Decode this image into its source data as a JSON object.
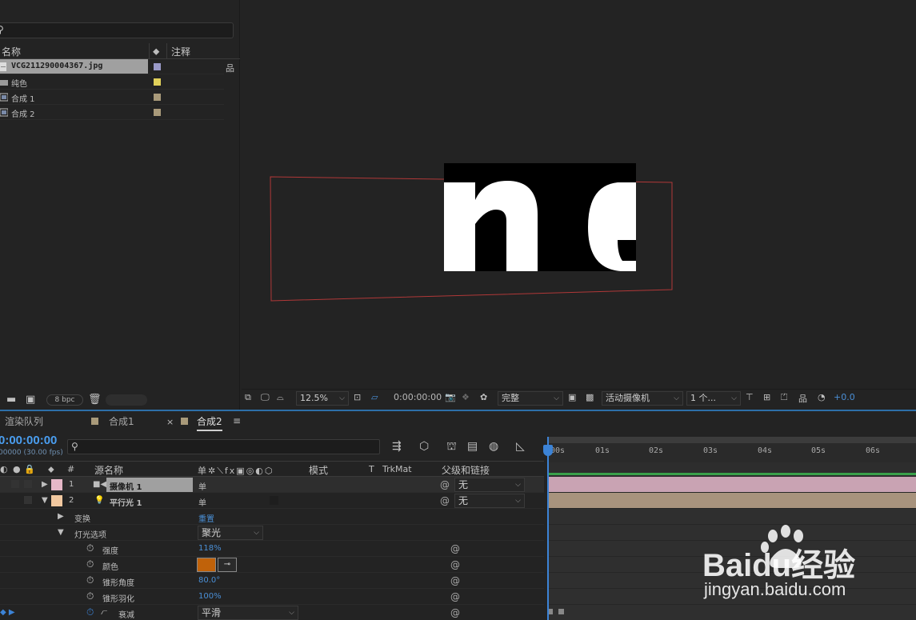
{
  "project": {
    "column_name": "名称",
    "column_comment": "注释",
    "items": [
      {
        "name": "VCG211290004367.jpg",
        "icon": "file-icon",
        "color": "#9a9ac8"
      },
      {
        "name": "纯色",
        "icon": "folder-icon",
        "color": "#e0d05a"
      },
      {
        "name": "合成 1",
        "icon": "composition-icon",
        "color": "#a99a7a"
      },
      {
        "name": "合成 2",
        "icon": "composition-icon",
        "color": "#a99a7a"
      }
    ],
    "bpc_label": "8 bpc"
  },
  "viewer": {
    "zoom": "12.5%",
    "timecode": "0:00:00:00",
    "resolution": "完整",
    "camera": "活动摄像机",
    "views": "1 个...",
    "exposure": "+0.0",
    "artwork_text": "ne"
  },
  "timeline": {
    "tabs": [
      {
        "label": "渲染队列"
      },
      {
        "label": "合成1"
      },
      {
        "label": "合成2"
      }
    ],
    "current_time": "0:00:00:00",
    "fps_text": "00000 (30.00 fps)",
    "columns": {
      "number": "#",
      "source_name": "源名称",
      "mode": "模式",
      "t": "T",
      "trkmat": "TrkMat",
      "parent": "父级和链接"
    },
    "layers": [
      {
        "index": "1",
        "name": "摄像机 1",
        "color": "#e6b8c8",
        "parent": "无",
        "switch": "单"
      },
      {
        "index": "2",
        "name": "平行光 1",
        "color": "#f2c8a0",
        "parent": "无",
        "switch": "单"
      }
    ],
    "properties": {
      "transform_label": "变换",
      "transform_value": "重置",
      "light_options_label": "灯光选项",
      "light_type": "聚光",
      "intensity_label": "强度",
      "intensity_value": "118%",
      "color_label": "颜色",
      "color_value": "#c0620a",
      "cone_angle_label": "锥形角度",
      "cone_angle_value": "80.0°",
      "cone_feather_label": "锥形羽化",
      "cone_feather_value": "100%",
      "falloff_label": "衰减",
      "falloff_value": "平滑"
    },
    "ruler_ticks": [
      "00s",
      "01s",
      "02s",
      "03s",
      "04s",
      "05s",
      "06s"
    ],
    "track_colors": {
      "camera": "#c9a3b3",
      "light": "#a8937d",
      "work_area": "#3aa04a"
    }
  },
  "watermark": {
    "brand": "Baidu经验",
    "url": "jingyan.baidu.com"
  }
}
